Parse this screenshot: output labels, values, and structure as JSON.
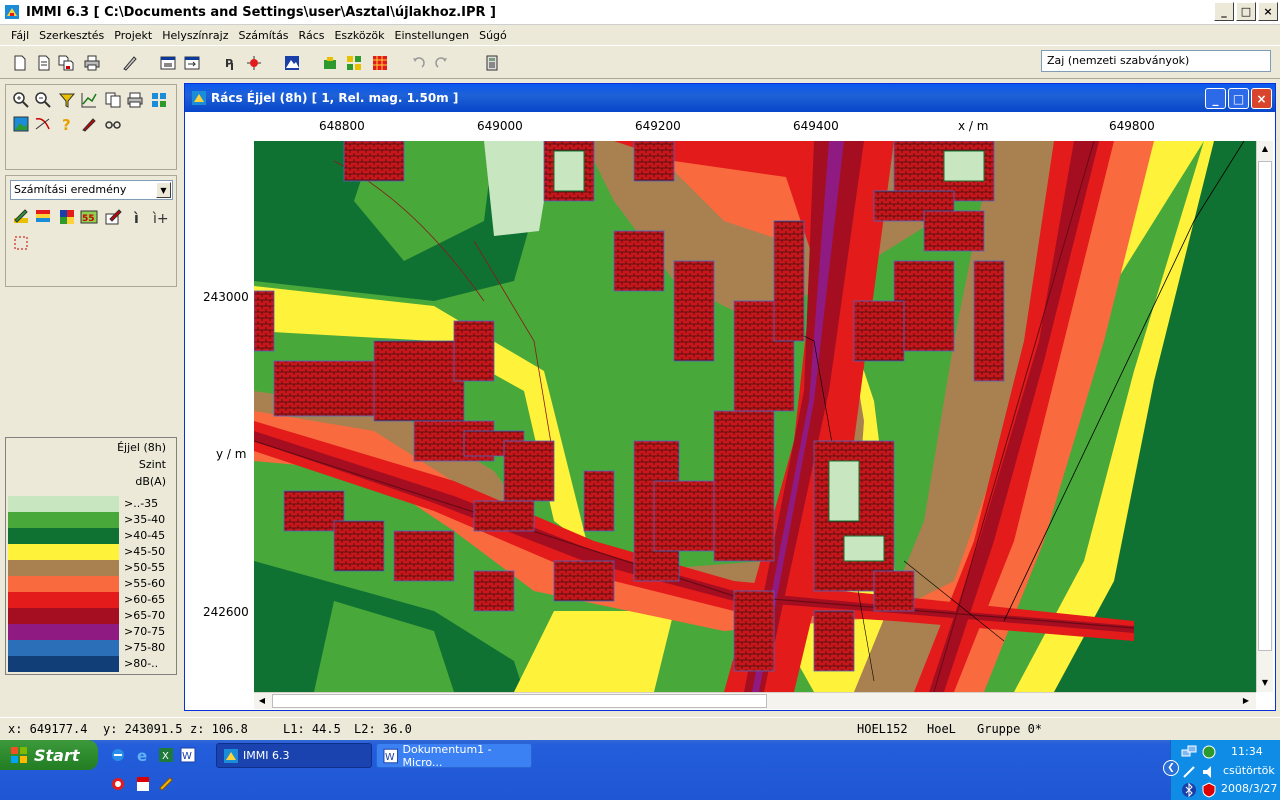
{
  "window": {
    "title": "IMMI 6.3 [ C:\\Documents and Settings\\user\\Asztal\\újlakhoz.IPR ]",
    "buttons": [
      "_",
      "□",
      "×"
    ]
  },
  "menu": [
    "Fájl",
    "Szerkesztés",
    "Projekt",
    "Helyszínrajz",
    "Számítás",
    "Rács",
    "Eszközök",
    "Einstellungen",
    "Súgó"
  ],
  "toolbar": {
    "noise_standard": "Zaj (nemzeti szabványok)"
  },
  "layer_panel": {
    "selected": "Számítási eredmény"
  },
  "legend": {
    "title_lines": [
      "Éjjel (8h)",
      "Szint",
      "dB(A)"
    ],
    "entries": [
      {
        "label": ">..-35",
        "color": "#c8e6c0"
      },
      {
        "label": ">35-40",
        "color": "#48a83a"
      },
      {
        "label": ">40-45",
        "color": "#107232"
      },
      {
        "label": ">45-50",
        "color": "#fff23a"
      },
      {
        "label": ">50-55",
        "color": "#a98151"
      },
      {
        "label": ">55-60",
        "color": "#f96a3f"
      },
      {
        "label": ">60-65",
        "color": "#e31b1b"
      },
      {
        "label": ">65-70",
        "color": "#a50e20"
      },
      {
        "label": ">70-75",
        "color": "#8f1a82"
      },
      {
        "label": ">75-80",
        "color": "#2a6fb8"
      },
      {
        "label": ">80-..",
        "color": "#123e78"
      }
    ]
  },
  "map_window": {
    "title": "Rács Éjjel (8h)  [ 1, Rel. mag.  1.50m ]",
    "x_ticks": [
      "648800",
      "649000",
      "649200",
      "649400",
      "649800"
    ],
    "x_axis_label": "x / m",
    "y_ticks": [
      "243000",
      "242600"
    ],
    "y_axis_label": "y / m"
  },
  "status": {
    "x": "x: 649177.4",
    "y": "y: 243091.5",
    "z": "z:  106.8",
    "l1": "L1: 44.5",
    "l2": "L2: 36.0",
    "code": "HOEL152",
    "name": "HoeL",
    "group": "Gruppe 0*"
  },
  "taskbar": {
    "start": "Start",
    "tasks": [
      "IMMI 6.3",
      "Dokumentum1 - Micro..."
    ],
    "time": "11:34",
    "day": "csütörtök",
    "date": "2008/3/27"
  }
}
